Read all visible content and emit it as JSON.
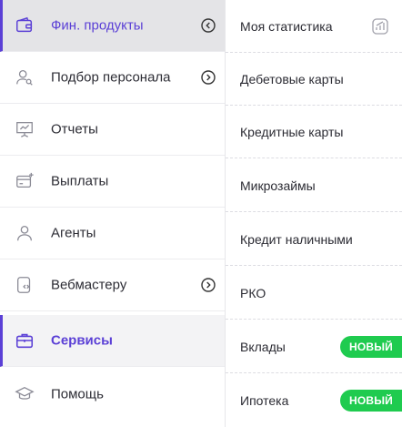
{
  "sidebar": {
    "items": [
      {
        "label": "Фин. продукты",
        "icon": "wallet-icon",
        "active": true,
        "arrow": "collapse"
      },
      {
        "label": "Подбор персонала",
        "icon": "user-search-icon",
        "arrow": "expand"
      },
      {
        "label": "Отчеты",
        "icon": "presentation-chart-icon"
      },
      {
        "label": "Выплаты",
        "icon": "card-plus-icon"
      },
      {
        "label": "Агенты",
        "icon": "user-icon"
      },
      {
        "label": "Вебмастеру",
        "icon": "code-device-icon",
        "arrow": "expand"
      },
      {
        "label": "Сервисы",
        "icon": "briefcase-icon",
        "active": true
      },
      {
        "label": "Помощь",
        "icon": "graduation-cap-icon"
      }
    ]
  },
  "submenu": {
    "items": [
      {
        "label": "Моя статистика",
        "icon": "stats-icon"
      },
      {
        "label": "Дебетовые карты"
      },
      {
        "label": "Кредитные карты"
      },
      {
        "label": "Микрозаймы"
      },
      {
        "label": "Кредит наличными"
      },
      {
        "label": "РКО"
      },
      {
        "label": "Вклады",
        "badge": "НОВЫЙ"
      },
      {
        "label": "Ипотека",
        "badge": "НОВЫЙ"
      }
    ]
  },
  "colors": {
    "accent": "#5b40d6",
    "badge": "#1fcb4f",
    "active_bg": "#e4e4e7"
  }
}
